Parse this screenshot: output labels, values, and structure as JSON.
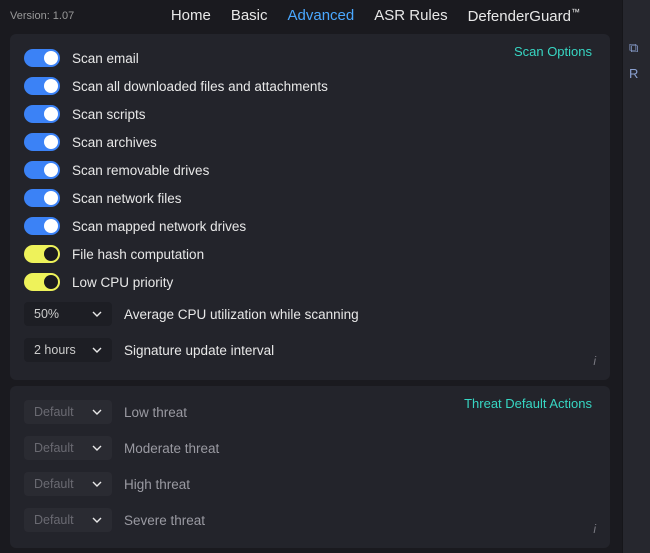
{
  "version_label": "Version: 1.07",
  "tabs": {
    "home": "Home",
    "basic": "Basic",
    "advanced": "Advanced",
    "asr": "ASR Rules",
    "guard": "DefenderGuard",
    "tm": "™"
  },
  "section1": {
    "title": "Scan Options",
    "toggles": [
      {
        "label": "Scan email",
        "state": "blue"
      },
      {
        "label": "Scan all downloaded files and attachments",
        "state": "blue"
      },
      {
        "label": "Scan scripts",
        "state": "blue"
      },
      {
        "label": "Scan archives",
        "state": "blue"
      },
      {
        "label": "Scan removable drives",
        "state": "blue"
      },
      {
        "label": "Scan network files",
        "state": "blue"
      },
      {
        "label": "Scan mapped network drives",
        "state": "blue"
      },
      {
        "label": "File hash computation",
        "state": "yellow"
      },
      {
        "label": "Low CPU priority",
        "state": "yellow"
      }
    ],
    "selects": [
      {
        "value": "50%",
        "label": "Average CPU utilization while scanning"
      },
      {
        "value": "2 hours",
        "label": "Signature update interval"
      }
    ]
  },
  "section2": {
    "title": "Threat Default Actions",
    "items": [
      {
        "value": "Default",
        "label": "Low threat"
      },
      {
        "value": "Default",
        "label": "Moderate threat"
      },
      {
        "value": "Default",
        "label": "High threat"
      },
      {
        "value": "Default",
        "label": "Severe threat"
      }
    ]
  },
  "info_glyph": "i",
  "strip": {
    "icon1": "⧉",
    "icon2": "R"
  }
}
